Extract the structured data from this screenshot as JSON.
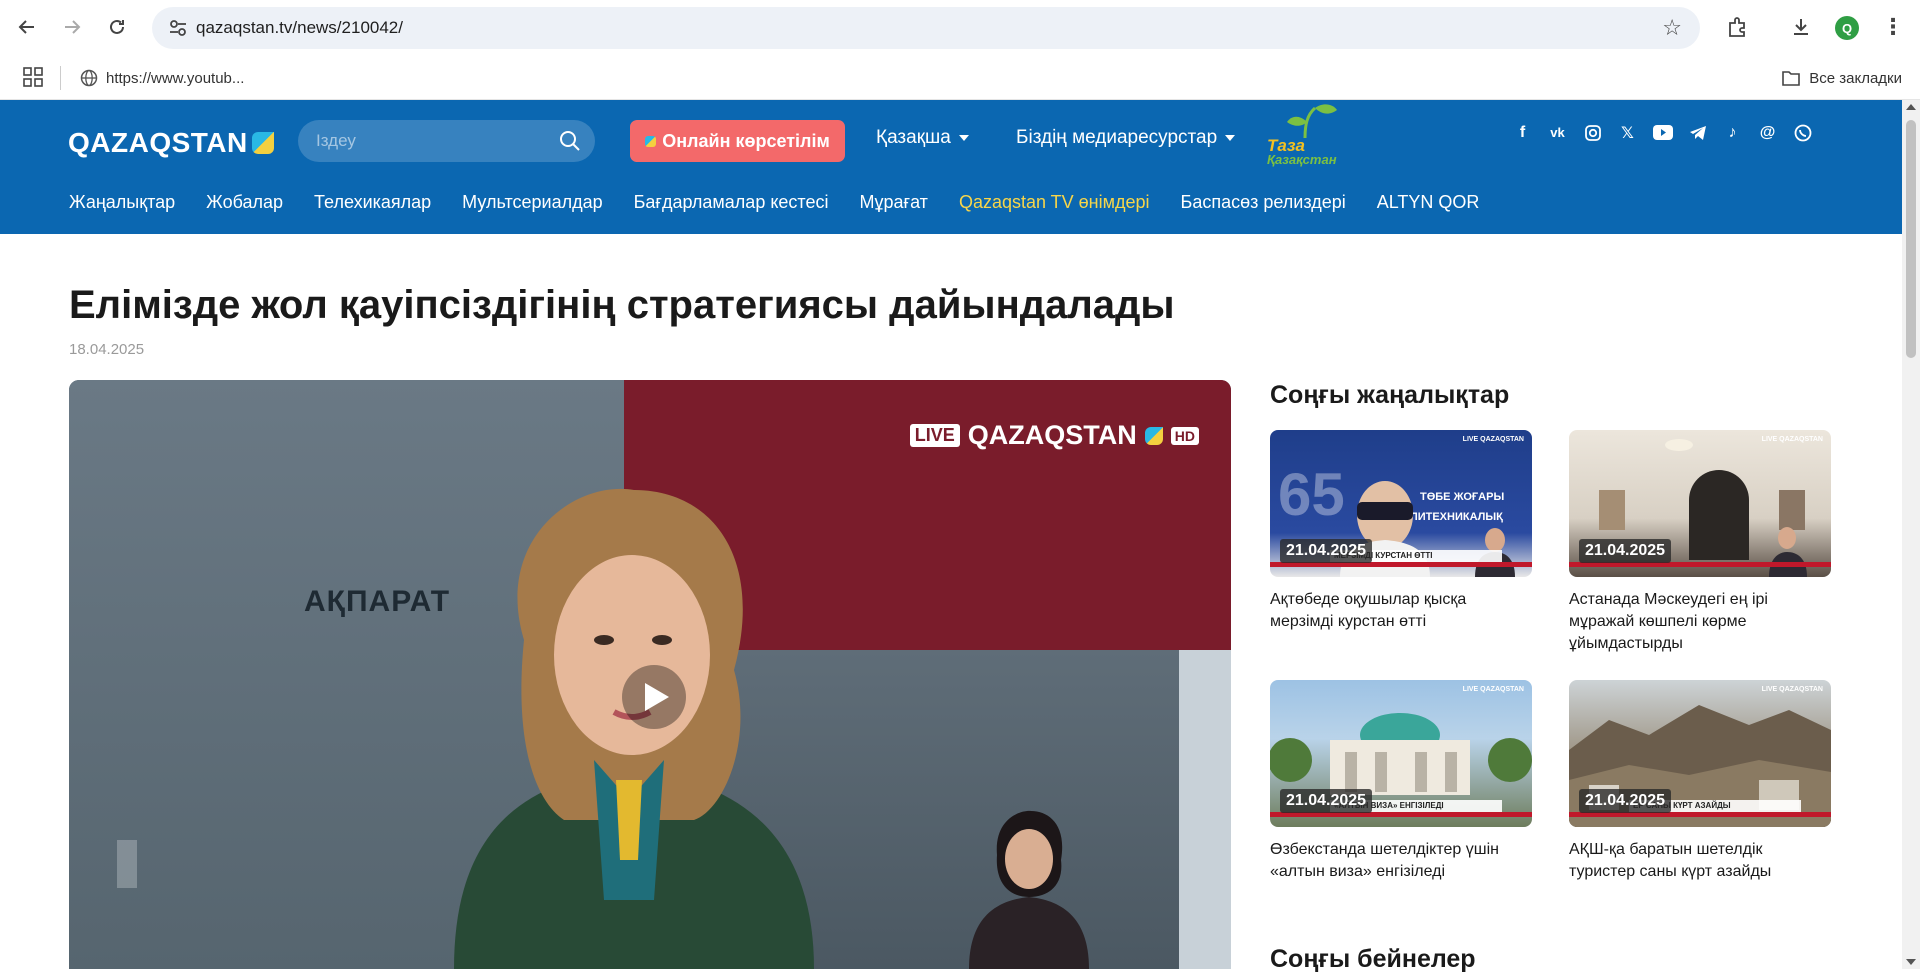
{
  "browser": {
    "url": "qazaqstan.tv/news/210042/",
    "bookmark_item": "https://www.youtub...",
    "all_bookmarks": "Все закладки",
    "profile_initial": "Q"
  },
  "header": {
    "logo": "QAZAQSTAN",
    "search_placeholder": "Іздеу",
    "live_button": "Онлайн көрсетілім",
    "language_dropdown": "Қазақша",
    "media_dropdown": "Біздің медиаресурстар",
    "taza_line1": "Таза",
    "taza_line2": "Қазақстан",
    "socials": [
      "facebook-icon",
      "vk-icon",
      "instagram-icon",
      "x-icon",
      "youtube-icon",
      "telegram-icon",
      "tiktok-icon",
      "threads-icon",
      "whatsapp-icon"
    ]
  },
  "nav": {
    "items": [
      {
        "label": "Жаңалықтар"
      },
      {
        "label": "Жобалар"
      },
      {
        "label": "Телехикаялар"
      },
      {
        "label": "Мультсериалдар"
      },
      {
        "label": "Бағдарламалар кестесі"
      },
      {
        "label": "Мұрағат"
      },
      {
        "label": "Qazaqstan TV өнімдері"
      },
      {
        "label": "Баспасөз релиздері"
      },
      {
        "label": "ALTYN QOR"
      }
    ]
  },
  "article": {
    "title": "Елімізде жол қауіпсіздігінің стратегиясы дайындалады",
    "date": "18.04.2025",
    "video": {
      "studio_text": "АҚПАРАТ",
      "live_label": "LIVE",
      "channel_name": "QAZAQSTAN",
      "hd_label": "HD"
    }
  },
  "sidebar": {
    "latest_news_title": "Соңғы жаңалықтар",
    "latest_videos_title": "Соңғы бейнелер",
    "cards": [
      {
        "date": "21.04.2025",
        "caption": "Ақтөбеде оқушылар қысқа мерзімді курстан өтті",
        "ticker": "МЕРЗІМДІ КУРСТАН ӨТТІ",
        "color_top": "#1f3e8a",
        "color_bottom": "#2a4aa0"
      },
      {
        "date": "21.04.2025",
        "caption": "Астанада Мәскеудегі ең ірі мұражай көшпелі көрме ұйымдастырды",
        "ticker": "",
        "color_top": "#ece6dc",
        "color_bottom": "#2b2724"
      },
      {
        "date": "21.04.2025",
        "caption": "Өзбекстанда шетелдіктер үшін «алтын виза» енгізіледі",
        "ticker": "«АЛТЫН ВИЗА» ЕНГІЗІЛЕДІ",
        "color_top": "#8fb4d9",
        "color_bottom": "#5b6b55"
      },
      {
        "date": "21.04.2025",
        "caption": "АҚШ-қа баратын шетелдік туристер саны күрт азайды",
        "ticker": "ЕР САНЫ КҮРТ АЗАЙДЫ",
        "color_top": "#c9cfd3",
        "color_bottom": "#6b6052"
      }
    ]
  }
}
